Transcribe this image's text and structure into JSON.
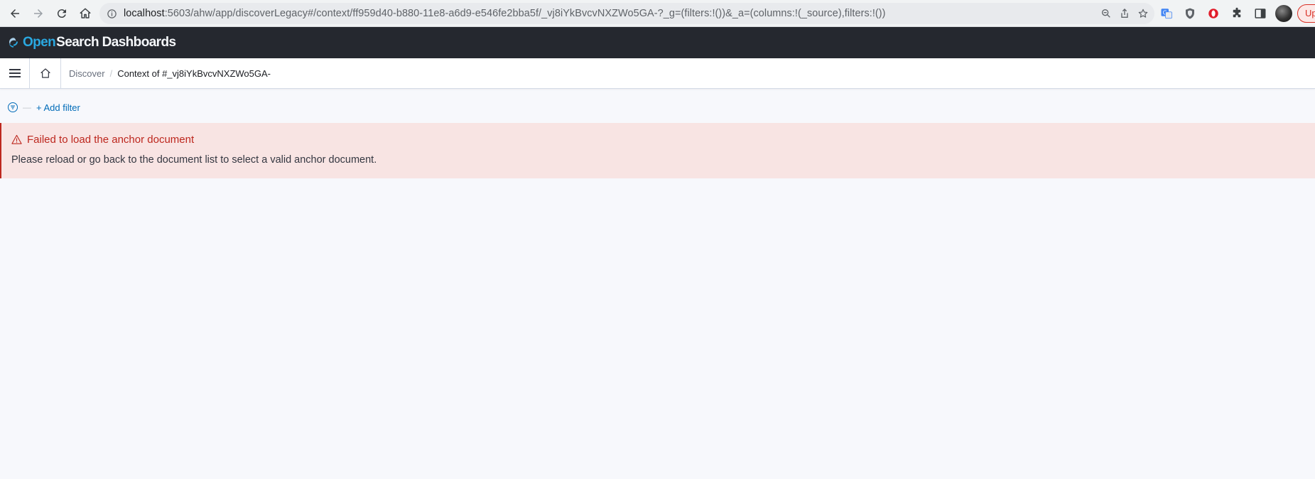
{
  "browser": {
    "url_host": "localhost",
    "url_path": ":5603/ahw/app/discoverLegacy#/context/ff959d40-b880-11e8-a6d9-e546fe2bba5f/_vj8iYkBvcvNXZWo5GA-?_g=(filters:!())&_a=(columns:!(_source),filters:!())",
    "update_label": "Up"
  },
  "app": {
    "logo_primary": "Open",
    "logo_secondary": "Search Dashboards"
  },
  "breadcrumbs": {
    "discover": "Discover",
    "current": "Context of #_vj8iYkBvcvNXZWo5GA-"
  },
  "filter": {
    "add_label": "+ Add filter"
  },
  "callout": {
    "title": "Failed to load the anchor document",
    "body": "Please reload or go back to the document list to select a valid anchor document."
  },
  "colors": {
    "header_bg": "#25282f",
    "logo_accent": "#2aa8e0",
    "link": "#006bb8",
    "danger": "#bd271e",
    "danger_bg": "#f8e4e3",
    "page_bg": "#f7f8fc"
  }
}
